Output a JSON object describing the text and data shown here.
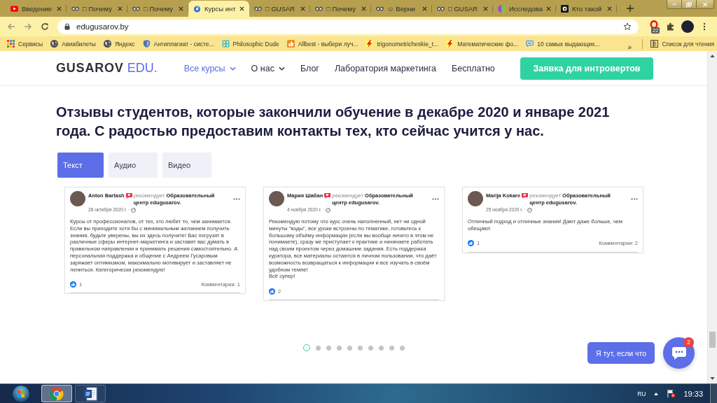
{
  "browser": {
    "tabs": [
      {
        "kind": "video",
        "title": "Введение",
        "selected": false
      },
      {
        "kind": "mask",
        "title": "□ Почему",
        "selected": false
      },
      {
        "kind": "mask",
        "title": "□ Почему",
        "selected": false
      },
      {
        "kind": "swirl",
        "title": "Курсы инт",
        "selected": true
      },
      {
        "kind": "mask",
        "title": "□ GUSAR",
        "selected": false
      },
      {
        "kind": "mask",
        "title": "□ Почему",
        "selected": false
      },
      {
        "kind": "mask",
        "title": "☺ Верни",
        "selected": false
      },
      {
        "kind": "mask",
        "title": "□ GUSAR",
        "selected": false
      },
      {
        "kind": "split",
        "title": "Исследова",
        "selected": false
      },
      {
        "kind": "dark",
        "title": "Кто такой",
        "selected": false
      }
    ],
    "address": "edugusarov.by",
    "extension_badge": "22",
    "bookmarks": [
      {
        "kind": "grid",
        "label": "Сервисы"
      },
      {
        "kind": "globe",
        "label": "Авиабилеты"
      },
      {
        "kind": "globe",
        "label": "Яндекс"
      },
      {
        "kind": "shield",
        "label": "Антиплагиат - систе..."
      },
      {
        "kind": "knot",
        "label": "Philosophic Dude"
      },
      {
        "kind": "thumb",
        "label": "Allbest - выбери луч..."
      },
      {
        "kind": "bolt",
        "label": "trigonometricheskie_t..."
      },
      {
        "kind": "bolt",
        "label": "Математические фо..."
      },
      {
        "kind": "bubble",
        "label": "10 самых выдающих..."
      }
    ],
    "bookmarks_more": "»",
    "reading_list": "Список для чтения"
  },
  "page": {
    "logo": {
      "name": "GUSAROV",
      "suffix": "EDU."
    },
    "nav": [
      {
        "label": "Все курсы",
        "selected": true,
        "dropdown": true
      },
      {
        "label": "О нас",
        "selected": false,
        "dropdown": true
      },
      {
        "label": "Блог",
        "selected": false,
        "dropdown": false
      },
      {
        "label": "Лаборатория маркетинга",
        "selected": false,
        "dropdown": false
      },
      {
        "label": "Бесплатно",
        "selected": false,
        "dropdown": false
      }
    ],
    "cta": "Заявка для интровертов",
    "heading": "Отзывы студентов, которые закончили обучение в декабре 2020 и январе 2021 года. С радостью предоставим контакты тех, кто сейчас учится у нас.",
    "media_tabs": [
      {
        "label": "Текст",
        "selected": true
      },
      {
        "label": "Аудио",
        "selected": false
      },
      {
        "label": "Видео",
        "selected": false
      }
    ],
    "reviews": [
      {
        "author": "Anton Bartash",
        "recommends": "рекомендует **Образовательный центр edugusarov.**",
        "date": "28 октября 2020 г. ·",
        "text": "Курсы от профессионалов, от тех, кто любит то, чем занимается. Если вы приходите хотя бы с минимальным желанием получить знания, будьте уверены, вы их здесь получите! Вас погрузят в различные сферы интернет-маркетинга и заставят вас думать в правильном направлении и принимать решения самостоятельно. А персональная поддержка и общение с Андреем Гусаровым заряжает оптимизмом, максимально мотивирует и заставляет не лениться. Категорически рекомендую!",
        "likes": "1",
        "comments": "Комментарии: 1"
      },
      {
        "author": "Мария Шабан",
        "recommends": "рекомендует **Образовательный центр edugusarov.**",
        "date": "4 ноября 2020 г. ·",
        "text": "Рекомендую потому что курс очень наполненный, нет ни одной минуты \"воды\", все уроки встроены по тематике, готовьтесь к большому объёму информации (если вы вообще ничего в этом не понимаете), сразу же приступает к практике и начинаете работать над своим проектом через домашние задания. Есть поддержка куратора, все материалы остаются в личном пользовании, что даёт возможность возвращаться к информации и все изучать в своём удобном темпе!\nВсё супер!",
        "likes": "2"
      },
      {
        "author": "Marija Kokare",
        "recommends": "рекомендует **Образовательный центр edugusarov.**",
        "date": "25 ноября 2020 г. ·",
        "text": "Отличный подход и отличные знания! Дают даже больше, чем обещают.",
        "likes": "1",
        "comments": "Комментарии: 2"
      }
    ],
    "slides": [
      {
        "selected": true
      },
      {
        "selected": false
      },
      {
        "selected": false
      },
      {
        "selected": false
      },
      {
        "selected": false
      },
      {
        "selected": false
      },
      {
        "selected": false
      },
      {
        "selected": false
      },
      {
        "selected": false
      },
      {
        "selected": false
      }
    ],
    "chat_prompt": "Я тут, если что",
    "chat_badge": "2"
  },
  "taskbar": {
    "apps": [
      {
        "kind": "browser",
        "selected": true
      },
      {
        "kind": "document",
        "selected": false
      }
    ],
    "language": "RU",
    "clock": "19:33"
  }
}
